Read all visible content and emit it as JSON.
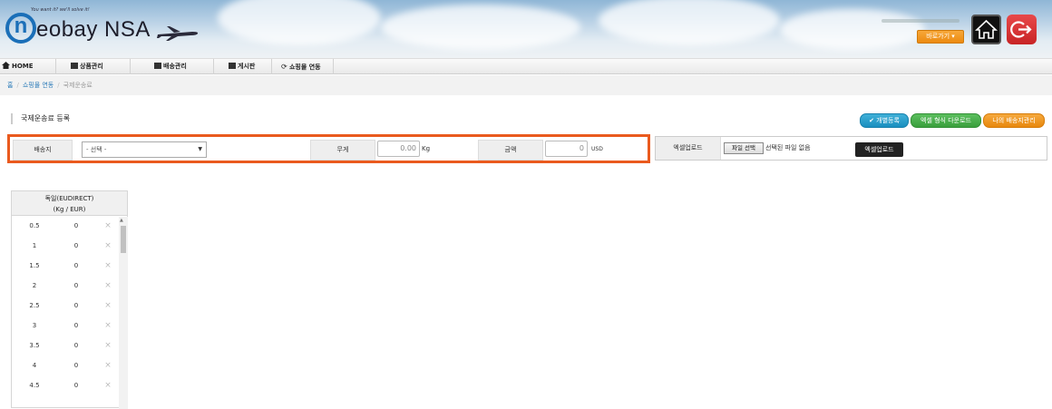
{
  "header": {
    "logo_slogan": "You want it?  we'll solve it!",
    "logo_letter": "n",
    "logo_word": "eobay NSA",
    "shortcut_label": "바로가기 ▾",
    "home_icon": "home-icon",
    "logout_icon": "logout-icon"
  },
  "nav": {
    "items": [
      {
        "label": "HOME",
        "icon": "home-icon"
      },
      {
        "label": "상품관리",
        "icon": "box-icon"
      },
      {
        "label": "배송관리",
        "icon": "truck-icon"
      },
      {
        "label": "게시판",
        "icon": "board-icon"
      },
      {
        "label": "쇼핑몰 연동",
        "icon": "refresh-icon"
      }
    ]
  },
  "breadcrumb": {
    "home": "홈",
    "parent": "쇼핑몰 연동",
    "current": "국제운송료"
  },
  "section": {
    "title": "국제운송료 등록",
    "buttons": {
      "individual": "✔ 개별등록",
      "excel_format": "엑셀 형식 다운로드",
      "my_shipping": "나의 배송지관리"
    }
  },
  "form": {
    "destination_label": "배송지",
    "destination_value": "- 선택 -",
    "weight_label": "무게",
    "weight_value": "0.00",
    "weight_unit": "Kg",
    "amount_label": "금액",
    "amount_value": "0",
    "amount_unit": "USD"
  },
  "excel": {
    "label": "엑셀업로드",
    "file_button": "파일 선택",
    "file_status": "선택된 파일 없음",
    "upload_button": "엑셀업로드"
  },
  "rate_table": {
    "header_line1": "독일(EUDIRECT)",
    "header_line2": "(Kg / EUR)",
    "rows": [
      {
        "weight": "0.5",
        "price": "0"
      },
      {
        "weight": "1",
        "price": "0"
      },
      {
        "weight": "1.5",
        "price": "0"
      },
      {
        "weight": "2",
        "price": "0"
      },
      {
        "weight": "2.5",
        "price": "0"
      },
      {
        "weight": "3",
        "price": "0"
      },
      {
        "weight": "3.5",
        "price": "0"
      },
      {
        "weight": "4",
        "price": "0"
      },
      {
        "weight": "4.5",
        "price": "0"
      }
    ],
    "delete_symbol": "×"
  }
}
